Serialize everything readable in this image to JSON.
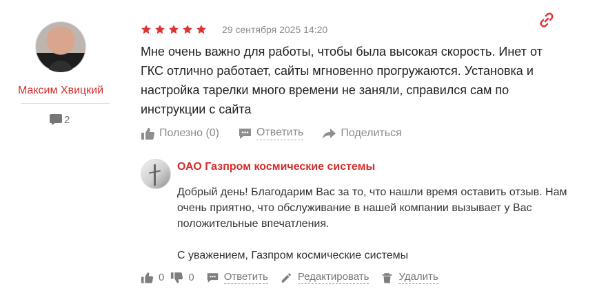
{
  "author": {
    "name": "Максим Хвицкий",
    "review_count": "2"
  },
  "review": {
    "rating": 5,
    "date": "29 сентября 2025 14:20",
    "text": "Мне очень важно для работы, чтобы была высокая скорость. Инет от ГКС отлично работает, сайты мгновенно прогружаются. Установка и настройка тарелки много времени не заняли, справился сам по инструкции с сайта",
    "actions": {
      "helpful": "Полезно (0)",
      "reply": "Ответить",
      "share": "Поделиться"
    }
  },
  "company_reply": {
    "company": "ОАО Газпром космические системы",
    "text": "Добрый день! Благодарим Вас за то, что нашли время оставить отзыв. Нам очень приятно, что обслуживание в нашей компании вызывает у Вас положительные впечатления.",
    "signature": "С уважением, Газпром космические системы",
    "likes": "0",
    "dislikes": "0",
    "actions": {
      "reply": "Ответить",
      "edit": "Редактировать",
      "delete": "Удалить"
    }
  },
  "colors": {
    "accent": "#d62b2b",
    "muted": "#888888"
  },
  "icons": [
    "chat-icon",
    "star-icon",
    "link-icon",
    "thumb-up-icon",
    "comment-icon",
    "share-icon",
    "thumb-down-icon",
    "pencil-icon",
    "trash-icon"
  ]
}
